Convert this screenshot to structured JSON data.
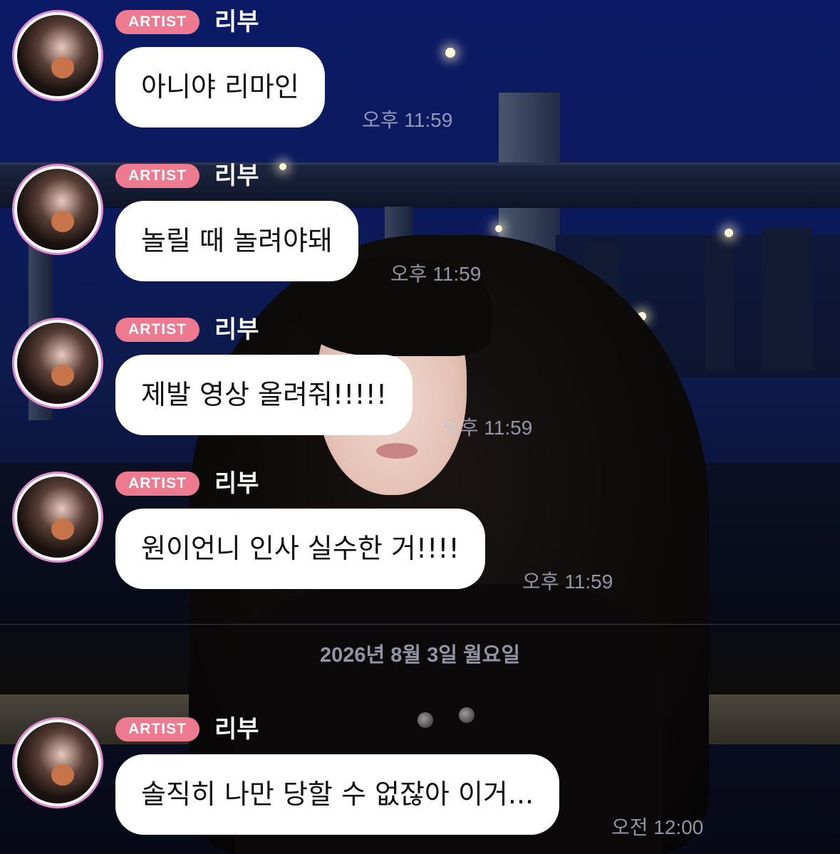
{
  "messages": [
    {
      "badge": "ARTIST",
      "sender": "리부",
      "text": "아니야 리마인",
      "time": "오후 11:59"
    },
    {
      "badge": "ARTIST",
      "sender": "리부",
      "text": "놀릴 때 놀려야돼",
      "time": "오후 11:59"
    },
    {
      "badge": "ARTIST",
      "sender": "리부",
      "text": "제발 영상 올려줘!!!!!",
      "time": "오후 11:59"
    },
    {
      "badge": "ARTIST",
      "sender": "리부",
      "text": "원이언니 인사 실수한 거!!!!",
      "time": "오후 11:59"
    },
    {
      "badge": "ARTIST",
      "sender": "리부",
      "text": "솔직히 나만 당할 수 없잖아 이거...",
      "time": "오전 12:00"
    }
  ],
  "date_separator": "2026년 8월 3일 월요일",
  "colors": {
    "badge": "#ee7a8f",
    "avatar_ring": "#e08ad0",
    "bubble": "#ffffff",
    "timestamp": "#bec3d7"
  },
  "icons": {
    "avatar": "profile-photo-avatar"
  }
}
